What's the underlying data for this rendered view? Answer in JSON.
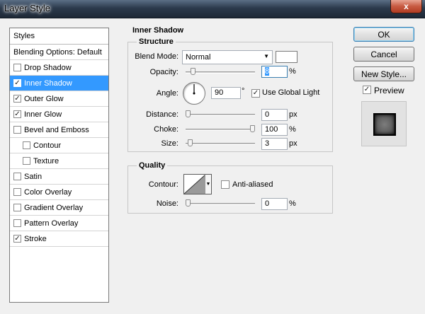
{
  "window": {
    "title": "Layer Style",
    "close_glyph": "x"
  },
  "styles_panel": {
    "header": "Styles",
    "blending_options": "Blending Options: Default",
    "items": [
      {
        "label": "Drop Shadow",
        "checked": false,
        "selected": false,
        "indent": false
      },
      {
        "label": "Inner Shadow",
        "checked": true,
        "selected": true,
        "indent": false
      },
      {
        "label": "Outer Glow",
        "checked": true,
        "selected": false,
        "indent": false
      },
      {
        "label": "Inner Glow",
        "checked": true,
        "selected": false,
        "indent": false
      },
      {
        "label": "Bevel and Emboss",
        "checked": false,
        "selected": false,
        "indent": false
      },
      {
        "label": "Contour",
        "checked": false,
        "selected": false,
        "indent": true
      },
      {
        "label": "Texture",
        "checked": false,
        "selected": false,
        "indent": true
      },
      {
        "label": "Satin",
        "checked": false,
        "selected": false,
        "indent": false
      },
      {
        "label": "Color Overlay",
        "checked": false,
        "selected": false,
        "indent": false
      },
      {
        "label": "Gradient Overlay",
        "checked": false,
        "selected": false,
        "indent": false
      },
      {
        "label": "Pattern Overlay",
        "checked": false,
        "selected": false,
        "indent": false
      },
      {
        "label": "Stroke",
        "checked": true,
        "selected": false,
        "indent": false
      }
    ]
  },
  "inner_shadow": {
    "section_title": "Inner Shadow",
    "structure": {
      "title": "Structure",
      "blend_mode_label": "Blend Mode:",
      "blend_mode_value": "Normal",
      "blend_color": "#ffffff",
      "opacity_label": "Opacity:",
      "opacity_value": "8",
      "opacity_unit": "%",
      "opacity_fraction": 0.08,
      "angle_label": "Angle:",
      "angle_value": "90",
      "angle_unit": "°",
      "angle_degrees": 90,
      "use_global_light_label": "Use Global Light",
      "use_global_light_checked": true,
      "distance_label": "Distance:",
      "distance_value": "0",
      "distance_unit": "px",
      "distance_fraction": 0.0,
      "choke_label": "Choke:",
      "choke_value": "100",
      "choke_unit": "%",
      "choke_fraction": 1.0,
      "size_label": "Size:",
      "size_value": "3",
      "size_unit": "px",
      "size_fraction": 0.03
    },
    "quality": {
      "title": "Quality",
      "contour_label": "Contour:",
      "anti_aliased_label": "Anti-aliased",
      "anti_aliased_checked": false,
      "noise_label": "Noise:",
      "noise_value": "0",
      "noise_unit": "%",
      "noise_fraction": 0.0
    }
  },
  "buttons": {
    "ok": "OK",
    "cancel": "Cancel",
    "new_style": "New Style...",
    "preview_label": "Preview",
    "preview_checked": true
  },
  "colors": {
    "selection": "#3399ff",
    "titlebar": "#2c3a4c",
    "close_button": "#c75a42"
  }
}
